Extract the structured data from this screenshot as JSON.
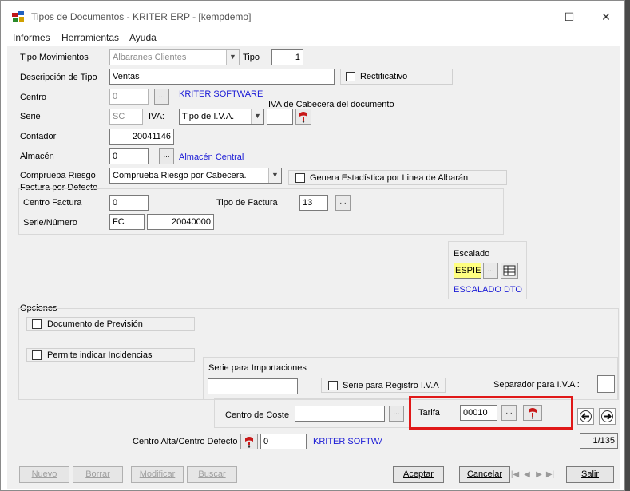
{
  "window": {
    "title": "Tipos de Documentos - KRITER ERP - [kempdemo]",
    "minimize": "—",
    "maximize": "☐",
    "close": "✕"
  },
  "menu": [
    "Informes",
    "Herramientas",
    "Ayuda"
  ],
  "form": {
    "tipo_movimientos": {
      "label": "Tipo Movimientos",
      "value": "Albaranes Clientes"
    },
    "tipo": {
      "label": "Tipo",
      "value": "1"
    },
    "descripcion": {
      "label": "Descripción de Tipo",
      "value": "Ventas"
    },
    "rectificativo": {
      "label": "Rectificativo",
      "checked": false
    },
    "centro": {
      "label": "Centro",
      "value": "0",
      "name": "KRITER SOFTWARE"
    },
    "iva_cabecera": {
      "label": "IVA de Cabecera del documento",
      "value": ""
    },
    "serie": {
      "label": "Serie",
      "value": "SC"
    },
    "iva": {
      "label": "IVA:",
      "value": "Tipo de I.V.A."
    },
    "contador": {
      "label": "Contador",
      "value": "20041146"
    },
    "almacen": {
      "label": "Almacén",
      "value": "0",
      "name": "Almacén Central"
    },
    "comprueba_riesgo": {
      "label": "Comprueba Riesgo",
      "value": "Comprueba Riesgo por Cabecera."
    },
    "genera_estadistica": {
      "label": "Genera Estadística por Linea de Albarán",
      "checked": false
    },
    "factura_por_defecto": {
      "group": "Factura por Defecto",
      "centro_factura": {
        "label": "Centro Factura",
        "value": "0"
      },
      "tipo_factura": {
        "label": "Tipo de Factura",
        "value": "13"
      },
      "serie_numero": {
        "label": "Serie/Número",
        "serie": "FC",
        "numero": "20040000"
      }
    },
    "escalado": {
      "label": "Escalado",
      "value": "ESPIE",
      "name": "ESCALADO DTO"
    },
    "opciones": {
      "group": "Opciones",
      "documento_prevision": {
        "label": "Documento de Previsión",
        "checked": false
      },
      "permite_incidencias": {
        "label": "Permite indicar Incidencias",
        "checked": false
      },
      "serie_importaciones": {
        "label": "Serie para Importaciones",
        "value": ""
      },
      "serie_registro_iva": {
        "label": "Serie para Registro I.V.A",
        "checked": false
      },
      "separador_iva": {
        "label": "Separador para I.V.A :",
        "value": ""
      }
    },
    "centro_coste": {
      "label": "Centro de Coste",
      "value": ""
    },
    "tarifa": {
      "label": "Tarifa",
      "value": "00010"
    },
    "centro_alta": {
      "label": "Centro Alta/Centro Defecto",
      "value": "0",
      "name": "KRITER SOFTWA"
    },
    "record_counter": "1/135"
  },
  "dots": "...",
  "buttons": {
    "nuevo": "Nuevo",
    "borrar": "Borrar",
    "modificar": "Modificar",
    "buscar": "Buscar",
    "aceptar": "Aceptar",
    "cancelar": "Cancelar",
    "salir": "Salir"
  },
  "colors": {
    "highlight": "#e01818",
    "link": "#1a1ad6",
    "escalado_bg": "#ffff80"
  }
}
